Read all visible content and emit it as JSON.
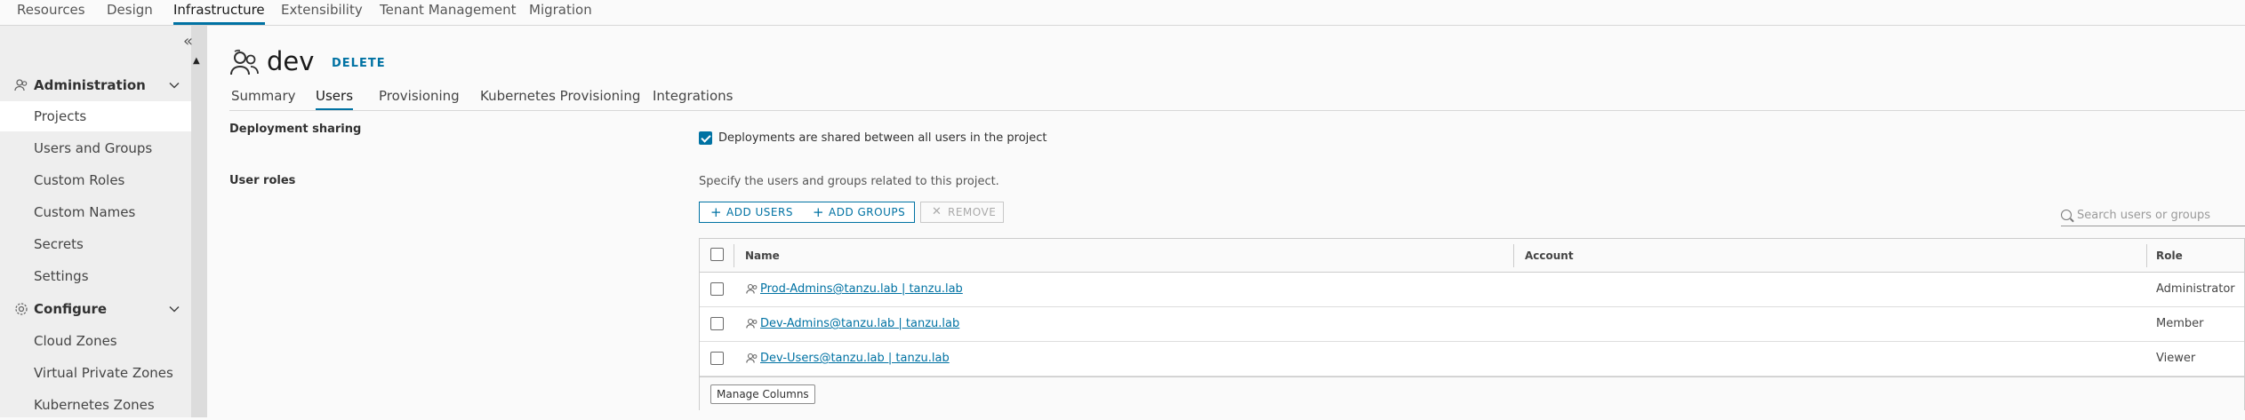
{
  "topnav": {
    "tabs": [
      "Resources",
      "Design",
      "Infrastructure",
      "Extensibility",
      "Tenant Management",
      "Migration"
    ],
    "active": "Infrastructure"
  },
  "sidebar": {
    "collapse_icon": "double-chevron-left-icon",
    "groups": [
      {
        "label": "Administration",
        "icon": "users-icon",
        "items": [
          "Projects",
          "Users and Groups",
          "Custom Roles",
          "Custom Names",
          "Secrets",
          "Settings"
        ]
      },
      {
        "label": "Configure",
        "icon": "gear-icon",
        "items": [
          "Cloud Zones",
          "Virtual Private Zones",
          "Kubernetes Zones"
        ]
      }
    ],
    "active_item": "Projects"
  },
  "project": {
    "name": "dev",
    "delete_label": "DELETE",
    "icon": "users-icon"
  },
  "subtabs": [
    "Summary",
    "Users",
    "Provisioning",
    "Kubernetes Provisioning",
    "Integrations"
  ],
  "active_subtab": "Users",
  "deployment_sharing": {
    "label": "Deployment sharing",
    "checkbox_label": "Deployments are shared between all users in the project",
    "checked": true
  },
  "user_roles": {
    "label": "User roles",
    "description": "Specify the users and groups related to this project.",
    "add_users_label": "ADD USERS",
    "add_groups_label": "ADD GROUPS",
    "remove_label": "REMOVE",
    "search_placeholder": "Search users or groups"
  },
  "grid": {
    "columns": [
      "Name",
      "Account",
      "Role"
    ],
    "rows": [
      {
        "name": "Prod-Admins@tanzu.lab | tanzu.lab",
        "account": "",
        "role": "Administrator"
      },
      {
        "name": "Dev-Admins@tanzu.lab | tanzu.lab",
        "account": "",
        "role": "Member"
      },
      {
        "name": "Dev-Users@tanzu.lab | tanzu.lab",
        "account": "",
        "role": "Viewer"
      }
    ],
    "manage_columns_label": "Manage Columns"
  },
  "colors": {
    "accent": "#0072a3",
    "sidebar_bg": "#eeeeee",
    "page_bg": "#fafafa"
  }
}
